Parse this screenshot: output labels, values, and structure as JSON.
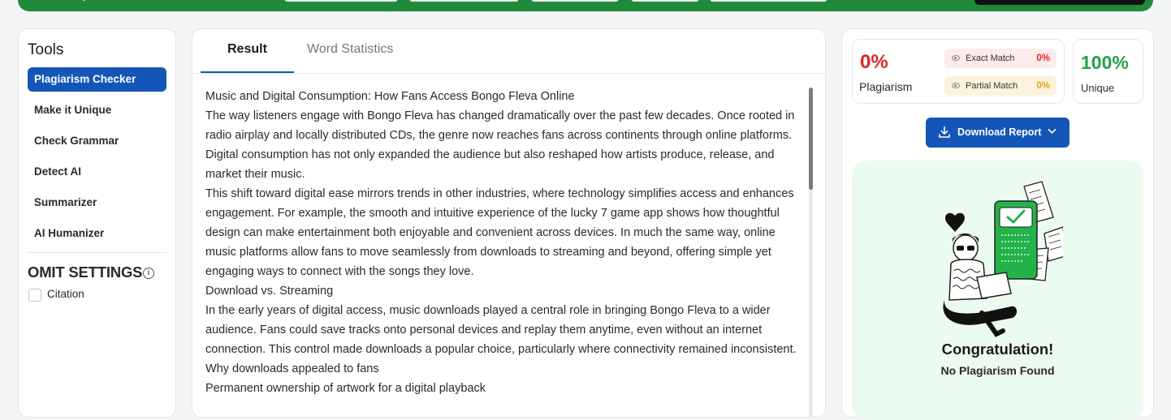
{
  "tools": {
    "title": "Tools",
    "items": [
      {
        "label": "Plagiarism Checker",
        "active": true
      },
      {
        "label": "Make it Unique",
        "active": false
      },
      {
        "label": "Check Grammar",
        "active": false
      },
      {
        "label": "Detect AI",
        "active": false
      },
      {
        "label": "Summarizer",
        "active": false
      },
      {
        "label": "AI Humanizer",
        "active": false
      }
    ],
    "omit_title": "OMIT SETTINGS",
    "info_glyph": "i",
    "citation_label": "Citation"
  },
  "result": {
    "tabs": [
      {
        "label": "Result",
        "active": true
      },
      {
        "label": "Word Statistics",
        "active": false
      }
    ],
    "article": [
      "Music and Digital Consumption: How Fans Access Bongo Fleva Online",
      "The way listeners engage with Bongo Fleva has changed dramatically over the past few decades. Once rooted in radio airplay and locally distributed CDs, the genre now reaches fans across continents through online platforms. Digital consumption has not only expanded the audience but also reshaped how artists produce, release, and market their music.",
      "This shift toward digital ease mirrors trends in other industries, where technology simplifies access and enhances engagement. For example, the smooth and intuitive experience of the lucky 7 game app shows how thoughtful design can make entertainment both enjoyable and convenient across devices. In much the same way, online music platforms allow fans to move seamlessly from downloads to streaming and beyond, offering simple yet engaging ways to connect with the songs they love.",
      "Download vs. Streaming",
      "In the early years of digital access, music downloads played a central role in bringing Bongo Fleva to a wider audience. Fans could save tracks onto personal devices and replay them anytime, even without an internet connection. This control made downloads a popular choice, particularly where connectivity remained inconsistent.",
      "Why downloads appealed to fans",
      "Permanent ownership of artwork for a digital playback"
    ]
  },
  "report": {
    "plagiarism_pct": "0%",
    "plagiarism_label": "Plagiarism",
    "exact_label": "Exact Match",
    "exact_value": "0%",
    "partial_label": "Partial Match",
    "partial_value": "0%",
    "unique_pct": "100%",
    "unique_label": "Unique",
    "download_label": "Download Report",
    "congrats_title": "Congratulation!",
    "congrats_sub": "No Plagiarism Found"
  },
  "colors": {
    "brand_blue": "#1456b8",
    "danger_red": "#e02424",
    "warn_amber": "#e0a10b",
    "success_green": "#24a148",
    "banner_green": "#1f8a3a"
  }
}
